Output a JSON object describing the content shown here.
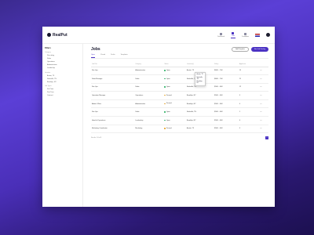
{
  "app": {
    "name": "RealPut"
  },
  "topnav": {
    "items": [
      {
        "label": "Dashboard"
      },
      {
        "label": "Jobs"
      },
      {
        "label": "Candidates"
      }
    ]
  },
  "sidebar": {
    "title": "Filters",
    "groups": [
      {
        "title": "Category",
        "items": [
          {
            "label": "Recruiting"
          },
          {
            "label": "Sales"
          },
          {
            "label": "Operations"
          },
          {
            "label": "Administrative"
          },
          {
            "label": "Leadership"
          }
        ]
      },
      {
        "title": "Location",
        "items": [
          {
            "label": "Austin, TX"
          },
          {
            "label": "Nashville, TN"
          },
          {
            "label": "Brooklyn, NY"
          }
        ]
      },
      {
        "title": "Job Types",
        "items": [
          {
            "label": "Full Time"
          },
          {
            "label": "Part Time"
          },
          {
            "label": "Contract"
          }
        ]
      }
    ]
  },
  "main": {
    "title": "Jobs",
    "btn_secondary": "Add Template",
    "btn_primary": "New Job Posting",
    "tabs": [
      {
        "label": "Open"
      },
      {
        "label": "Closed"
      },
      {
        "label": "Drafts"
      },
      {
        "label": "Templates"
      }
    ],
    "columns": [
      "Job Title",
      "Category",
      "Status",
      "Location(s)",
      "Salary",
      "Applicants"
    ],
    "rows": [
      {
        "title": "Site Ops",
        "category": "Administrative",
        "status": "Open",
        "location": "Austin, TX",
        "salary": "$60K – 70K",
        "applicants": "15"
      },
      {
        "title": "Sales Manager",
        "category": "Sales",
        "status": "Open",
        "location": "Nashville, TN",
        "salary": "$60K – 70K",
        "applicants": "21"
      },
      {
        "title": "Site Ops",
        "category": "Sales",
        "status": "Open",
        "location": "Nashville, TN",
        "salary": "$50K – 60K",
        "applicants": "12"
      },
      {
        "title": "Operation Manager",
        "category": "Operations",
        "status": "Paused",
        "location": "Brooklyn, NY",
        "salary": "$50K – 60K",
        "applicants": "9"
      },
      {
        "title": "Admin Officer",
        "category": "Administrative",
        "status": "Paused",
        "location": "Brooklyn, NY",
        "salary": "$50K – 60K",
        "applicants": "4"
      },
      {
        "title": "Site Ops",
        "category": "Sales",
        "status": "Open",
        "location": "Nashville, TN",
        "salary": "$50K – 60K",
        "applicants": "1"
      },
      {
        "title": "Head of Operations",
        "category": "Leadership",
        "status": "Open",
        "location": "Brooklyn, NY",
        "salary": "$50K – 60K",
        "applicants": "6"
      },
      {
        "title": "Marketing Coordinator",
        "category": "Marketing",
        "status": "Paused",
        "location": "Austin, TX",
        "salary": "$50K – 60K",
        "applicants": "3"
      }
    ],
    "location_dropdown": [
      "Austin, TX",
      "Nashville, TN",
      "Brooklyn, NY"
    ],
    "footer_text": "Results: 1-8 of 8",
    "page": "1"
  },
  "colors": {
    "accent": "#4b32c3",
    "open": "#34b36b",
    "paused": "#e5a530"
  }
}
